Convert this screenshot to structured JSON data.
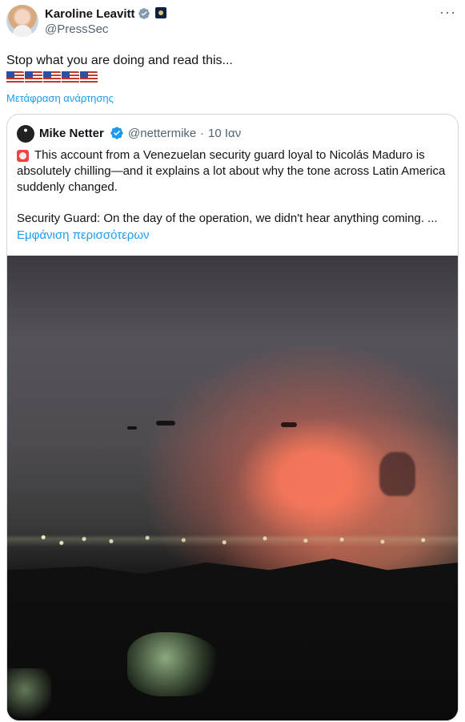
{
  "post": {
    "author": {
      "name": "Karoline Leavitt",
      "handle": "@PressSec",
      "verified_badge": "gray-verified-icon",
      "affiliation_badge": "government-icon"
    },
    "more_icon": "more-options-icon",
    "text": "Stop what you are doing and read this...",
    "flags": [
      "us-flag-icon",
      "us-flag-icon",
      "us-flag-icon",
      "us-flag-icon",
      "us-flag-icon"
    ],
    "translate_label": "Μετάφραση ανάρτησης"
  },
  "quote": {
    "author": {
      "name": "Mike Netter",
      "handle": "@nettermike",
      "separator": "·",
      "time": "10 Ιαν",
      "verified_badge": "blue-verified-icon"
    },
    "siren_icon": "siren-icon",
    "body": "This account from a Venezuelan security guard loyal to Nicolás Maduro is absolutely chilling—and it explains a lot about why the tone across Latin America suddenly changed.",
    "body2": "Security Guard: On the day of the operation, we didn't hear anything coming. ...",
    "show_more": "Εμφάνιση περισσότερων",
    "media": {
      "type": "night-video-still"
    }
  },
  "colors": {
    "primary_text": "#0f1419",
    "secondary_text": "#536471",
    "link": "#1d9bf0",
    "border": "#cfd9de"
  }
}
